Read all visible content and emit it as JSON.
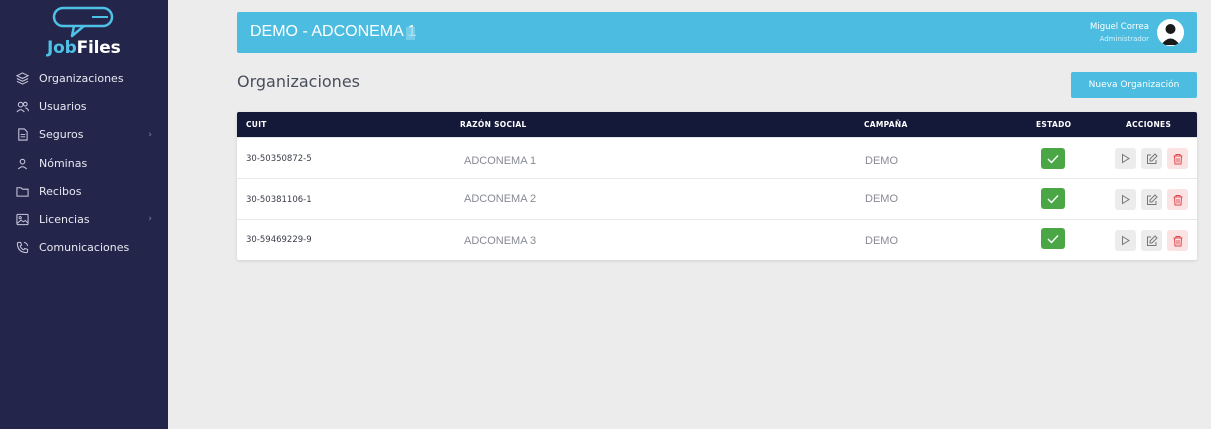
{
  "brand": {
    "logo_job": "Job",
    "logo_files": "Files"
  },
  "sidebar": {
    "items": [
      {
        "label": "Organizaciones",
        "icon": "layers-icon"
      },
      {
        "label": "Usuarios",
        "icon": "users-icon"
      },
      {
        "label": "Seguros",
        "icon": "document-icon",
        "has_submenu": true
      },
      {
        "label": "Nóminas",
        "icon": "user-icon"
      },
      {
        "label": "Recibos",
        "icon": "folder-icon"
      },
      {
        "label": "Licencias",
        "icon": "image-icon",
        "has_submenu": true
      },
      {
        "label": "Comunicaciones",
        "icon": "phone-icon"
      }
    ]
  },
  "header": {
    "title": "DEMO - ADCONEMA 1",
    "user_name": "Miguel Correa",
    "user_role": "Administrador"
  },
  "page": {
    "title": "Organizaciones",
    "new_button": "Nueva Organización"
  },
  "table": {
    "columns": [
      "CUIT",
      "RAZÓN SOCIAL",
      "CAMPAÑA",
      "ESTADO",
      "ACCIONES"
    ],
    "rows": [
      {
        "cuit": "30-50350872-5",
        "razon": "ADCONEMA 1",
        "campana": "DEMO",
        "estado": "active"
      },
      {
        "cuit": "30-50381106-1",
        "razon": "ADCONEMA 2",
        "campana": "DEMO",
        "estado": "active"
      },
      {
        "cuit": "30-59469229-9",
        "razon": "ADCONEMA 3",
        "campana": "DEMO",
        "estado": "active"
      }
    ]
  },
  "colors": {
    "sidebar_bg": "#23264a",
    "accent": "#4cbde0",
    "table_header": "#14193a",
    "status_active": "#4ba745",
    "delete": "#e0474c"
  }
}
